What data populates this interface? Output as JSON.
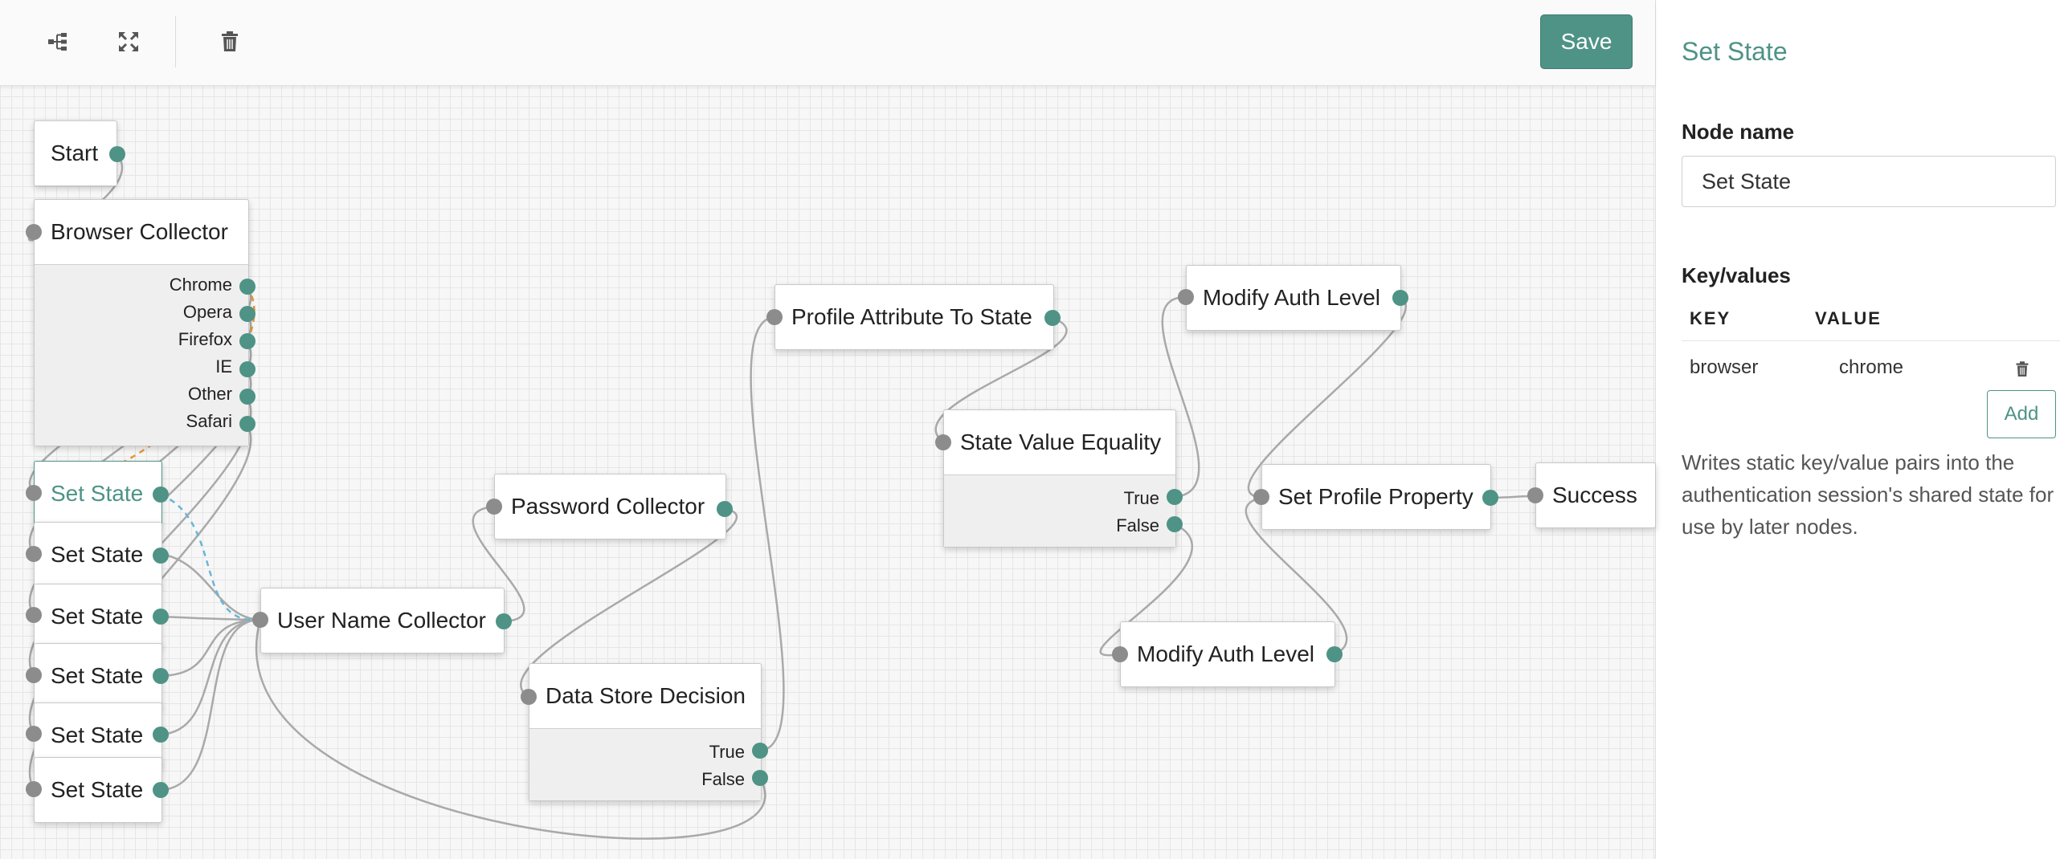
{
  "toolbar": {
    "tree_icon": "tree-layout-icon",
    "expand_icon": "expand-icon",
    "delete_icon": "trash-icon",
    "save_label": "Save"
  },
  "colors": {
    "accent": "#4e9386",
    "input_port": "#8c8c8c",
    "wire": "#a9a9a9",
    "wire_selected_orange": "#e8953a",
    "wire_selected_blue": "#6ab6d6"
  },
  "nodes": {
    "start": {
      "title": "Start"
    },
    "browser_collector": {
      "title": "Browser Collector",
      "outcomes": [
        "Chrome",
        "Opera",
        "Firefox",
        "IE",
        "Other",
        "Safari"
      ]
    },
    "set_state_1": {
      "title": "Set State"
    },
    "set_state_2": {
      "title": "Set State"
    },
    "set_state_3": {
      "title": "Set State"
    },
    "set_state_4": {
      "title": "Set State"
    },
    "set_state_5": {
      "title": "Set State"
    },
    "set_state_6": {
      "title": "Set State"
    },
    "user_name_collector": {
      "title": "User Name Collector"
    },
    "password_collector": {
      "title": "Password Collector"
    },
    "data_store_decision": {
      "title": "Data Store Decision",
      "outcomes": [
        "True",
        "False"
      ]
    },
    "profile_attribute_to_state": {
      "title": "Profile Attribute To State"
    },
    "state_value_equality": {
      "title": "State Value Equality",
      "outcomes": [
        "True",
        "False"
      ]
    },
    "modify_auth_level_1": {
      "title": "Modify Auth Level"
    },
    "modify_auth_level_2": {
      "title": "Modify Auth Level"
    },
    "set_profile_property": {
      "title": "Set Profile Property"
    },
    "success": {
      "title": "Success"
    }
  },
  "panel": {
    "title": "Set State",
    "node_name_label": "Node name",
    "node_name_value": "Set State",
    "keyvalues_label": "Key/values",
    "col_key": "KEY",
    "col_value": "VALUE",
    "rows": [
      {
        "key": "browser",
        "value": "chrome"
      }
    ],
    "add_label": "Add",
    "description": "Writes static key/value pairs into the authentication session's shared state for use by later nodes."
  }
}
